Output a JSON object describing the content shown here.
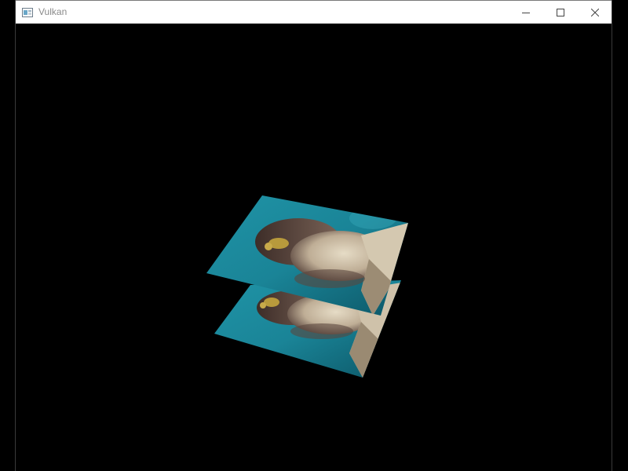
{
  "window": {
    "title": "Vulkan",
    "icon": "app-window-icon",
    "controls": [
      {
        "name": "minimize",
        "icon": "minimize-icon"
      },
      {
        "name": "maximize",
        "icon": "maximize-icon"
      },
      {
        "name": "close",
        "icon": "close-icon"
      }
    ]
  },
  "scene": {
    "background": "#000000",
    "quads": [
      {
        "name": "upper-textured-quad",
        "texture": "statue-head-on-teal"
      },
      {
        "name": "lower-textured-quad",
        "texture": "statue-head-on-teal"
      }
    ],
    "colors": {
      "teal_light": "#2aa3b3",
      "teal_dark": "#0d4f5e",
      "stone": "#d8cdb8",
      "stone_shadow": "#6c5a4e",
      "gold": "#b89a3c"
    }
  }
}
